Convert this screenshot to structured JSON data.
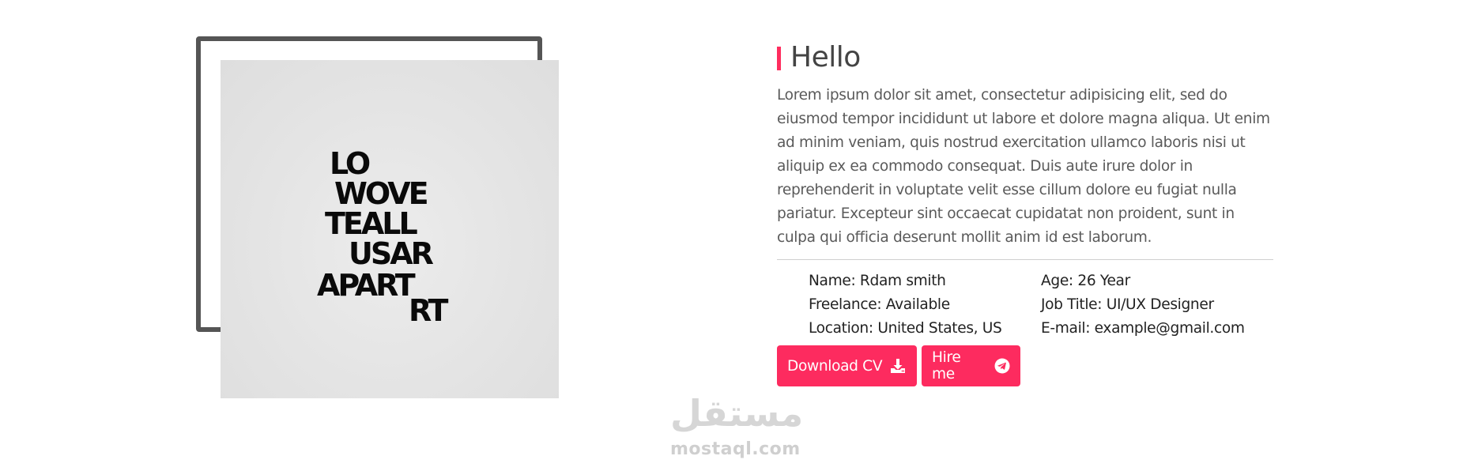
{
  "about": {
    "heading": "Hello",
    "description": "Lorem ipsum dolor sit amet, consectetur adipisicing elit, sed do eiusmod tempor incididunt ut labore et dolore magna aliqua. Ut enim ad minim veniam, quis nostrud exercitation ullamco laboris nisi ut aliquip ex ea commodo consequat. Duis aute irure dolor in reprehenderit in voluptate velit esse cillum dolore eu fugiat nulla pariatur. Excepteur sint occaecat cupidatat non proident, sunt in culpa qui officia deserunt mollit anim id est laborum.",
    "info": {
      "name": "Name: Rdam smith",
      "age": "Age: 26 Year",
      "freelance": "Freelance: Available",
      "job_title": "Job Title: UI/UX Designer",
      "location": "Location: United States, US",
      "email": "E-mail: example@gmail.com"
    },
    "buttons": {
      "download_label": "Download CV",
      "download_icon": "download-icon",
      "hire_label": "Hire me",
      "hire_icon": "telegram-icon"
    }
  },
  "poster": {
    "lines": [
      "LO",
      "WOVE",
      "TEALL",
      "USAR",
      "APART",
      "RT"
    ]
  },
  "watermark": {
    "arabic": "مستقل",
    "latin": "mostaql.com"
  },
  "colors": {
    "accent": "#fd2b5f",
    "heading_bar": "#ff2d5e",
    "frame": "#555555",
    "photo_bg": "#e3e3e3"
  }
}
